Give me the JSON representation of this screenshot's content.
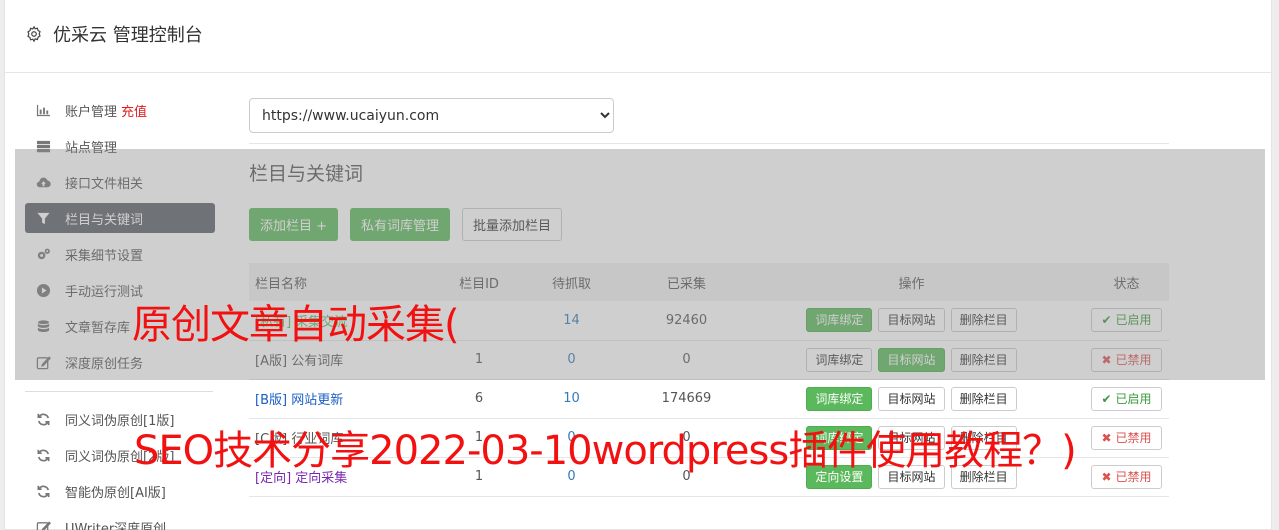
{
  "header": {
    "title": "优采云 管理控制台",
    "icon": "gear-icon"
  },
  "sidebar": {
    "items": [
      {
        "label": "账户管理",
        "extra": "充值",
        "icon": "bar-chart-icon"
      },
      {
        "label": "站点管理",
        "icon": "server-icon"
      },
      {
        "label": "接口文件相关",
        "icon": "cloud-upload-icon"
      },
      {
        "label": "栏目与关键词",
        "icon": "filter-icon",
        "active": true
      },
      {
        "label": "采集细节设置",
        "icon": "cogs-icon"
      },
      {
        "label": "手动运行测试",
        "icon": "play-circle-icon"
      },
      {
        "label": "文章暂存库",
        "icon": "database-icon"
      },
      {
        "label": "深度原创任务",
        "icon": "edit-icon"
      }
    ],
    "items2": [
      {
        "label": "同义词伪原创[1版]",
        "icon": "refresh-icon"
      },
      {
        "label": "同义词伪原创[2版]",
        "icon": "refresh-icon"
      },
      {
        "label": "智能伪原创[AI版]",
        "icon": "refresh-icon"
      },
      {
        "label": "UWriter深度原创",
        "icon": "edit-icon"
      }
    ]
  },
  "main": {
    "site_select": "https://www.ucaiyun.com",
    "section_title": "栏目与关键词",
    "buttons": {
      "add": "添加栏目 +",
      "private": "私有词库管理",
      "batch": "批量添加栏目"
    },
    "table": {
      "headers": [
        "栏目名称",
        "栏目ID",
        "待抓取",
        "已采集",
        "操作",
        "状态"
      ],
      "rows": [
        {
          "tag": "[私有]",
          "name": "采集交流",
          "id": "",
          "pending": "14",
          "collected": "92460",
          "op1": "词库绑定",
          "op2": "目标网站",
          "op3": "删除栏目",
          "status": "已启用"
        },
        {
          "tag": "[A版]",
          "name": "公有词库",
          "id": "1",
          "pending": "0",
          "collected": "0",
          "op1": "词库绑定",
          "op2": "目标网站",
          "op3": "删除栏目",
          "status": "已禁用"
        },
        {
          "tag": "[B版]",
          "name": "网站更新",
          "id": "6",
          "pending": "10",
          "collected": "174669",
          "op1": "词库绑定",
          "op2": "目标网站",
          "op3": "删除栏目",
          "status": "已启用"
        },
        {
          "tag": "[C版]",
          "name": "行业词库",
          "id": "1",
          "pending": "0",
          "collected": "0",
          "op1": "词库绑定",
          "op2": "目标网站",
          "op3": "删除栏目",
          "status": "已禁用"
        },
        {
          "tag": "[定向]",
          "name": "定向采集",
          "id": "1",
          "pending": "0",
          "collected": "0",
          "op1": "定向设置",
          "op2": "目标网站",
          "op3": "删除栏目",
          "status": "已禁用"
        }
      ]
    }
  },
  "watermark": {
    "line1": "原创文章自动采集(",
    "line2": "SEO技术分享2022-03-10wordpress插件使用教程？)"
  },
  "colors": {
    "green": "#5cb85c",
    "active_nav": "#5a5f66",
    "red": "#f21010"
  }
}
